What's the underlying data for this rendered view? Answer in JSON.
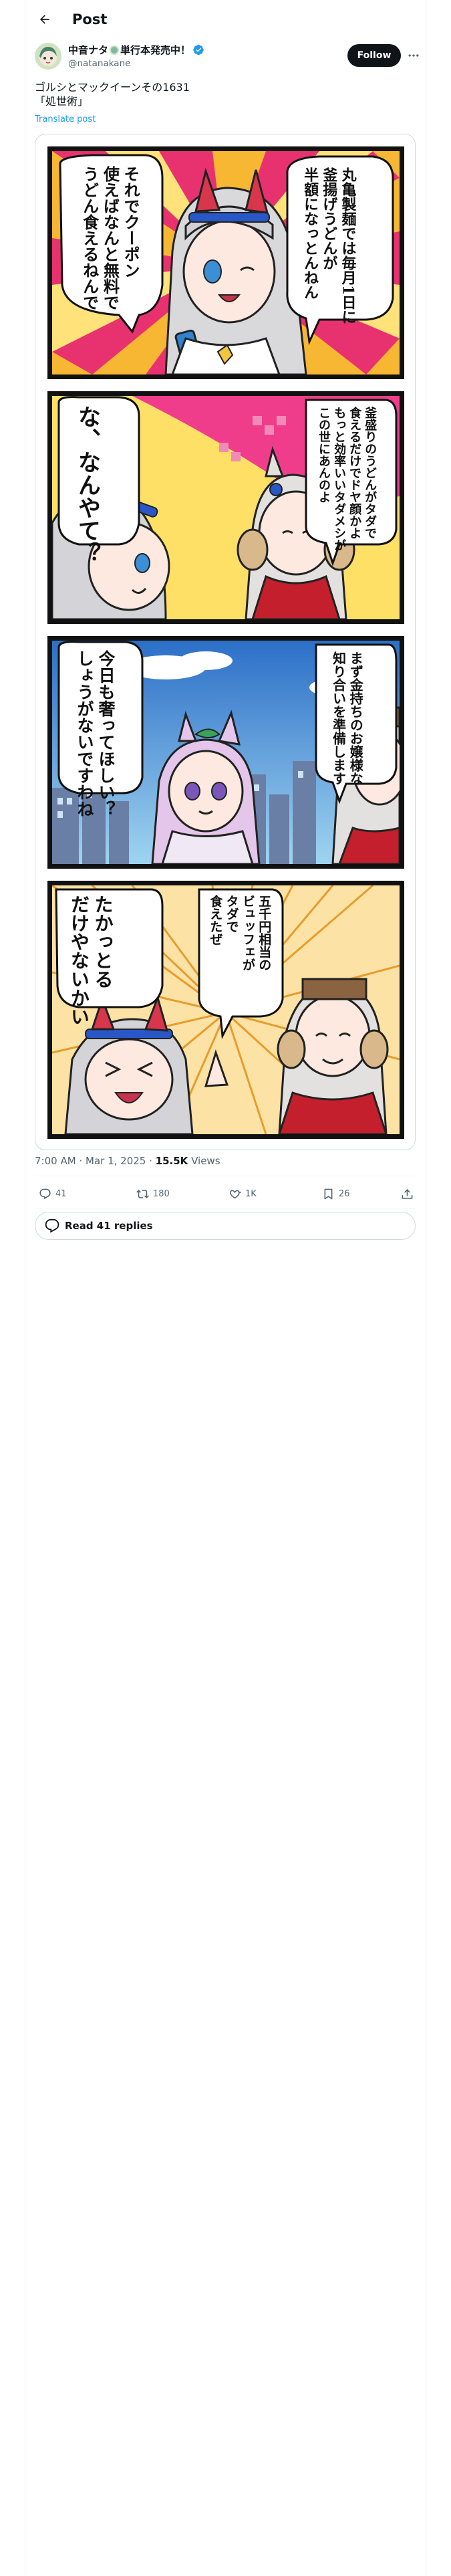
{
  "header": {
    "title": "Post"
  },
  "author": {
    "name_prefix": "中音ナタ",
    "name_suffix": "単行本発売中！",
    "handle": "@natanakane",
    "follow_label": "Follow"
  },
  "tweet": {
    "line1": "ゴルシとマックイーンその1631",
    "line2": "「処世術」",
    "translate_label": "Translate post"
  },
  "comic": {
    "panel1": {
      "bubble_left": "それでクーポン\n使えばなんと無料で\nうどん食えるねんで",
      "bubble_right": "丸亀製麺では毎月1日に\n釜揚げうどんが\n半額になっとんねん"
    },
    "panel2": {
      "bubble_left": "な、なんやて？",
      "bubble_right": "釜盛りのうどんがタダで\n食えるだけでドヤ顔かよ\nもっと効率いいタダメシが\nこの世にあんのよ"
    },
    "panel3": {
      "bubble_left": "今日も奢ってほしい？\nしょうがないですわね",
      "bubble_right": "まず金持ちのお嬢様な\n知り合いを準備します"
    },
    "panel4": {
      "bubble_left": "たかっとる\nだけやないかい",
      "bubble_right": "五千円相当の\nビュッフェが\nタダで\n食えたぜ"
    }
  },
  "meta": {
    "time": "7:00 AM",
    "sep": "·",
    "date": "Mar 1, 2025",
    "views_count": "15.5K",
    "views_label": "Views"
  },
  "actions": {
    "replies": "41",
    "reposts": "180",
    "likes": "1K",
    "bookmarks": "26"
  },
  "read_replies_label": "Read 41 replies",
  "colors": {
    "accent": "#1d9bf0",
    "text": "#0f1419",
    "muted": "#536471",
    "border": "#cfd9de"
  }
}
